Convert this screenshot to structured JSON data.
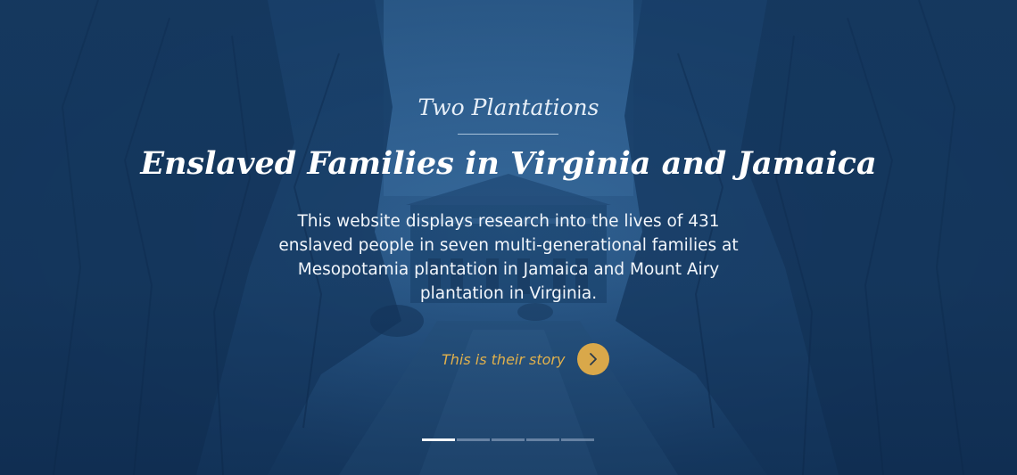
{
  "hero": {
    "eyebrow": "Two Plantations",
    "title": "Enslaved Families in Virginia and Jamaica",
    "description": "This website displays research into the lives of 431 enslaved people in seven multi-generational families at Mesopotamia plantation in Jamaica and Mount Airy plantation in Virginia.",
    "cta_label": "This is their story",
    "cta_icon": "chevron-right-icon",
    "accent_color": "#d9a84a",
    "background_color": "#1f4670"
  },
  "carousel": {
    "slide_count": 5,
    "active_index": 0
  }
}
